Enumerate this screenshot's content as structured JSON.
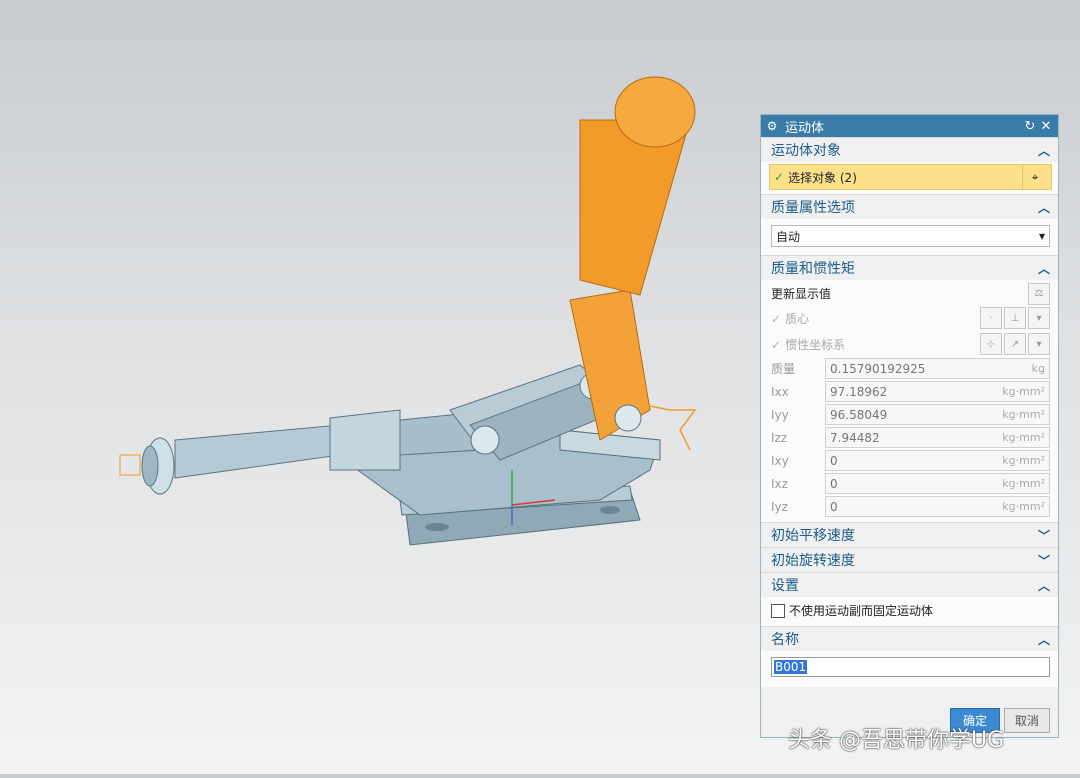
{
  "dialog": {
    "title": "运动体",
    "sections": {
      "object": {
        "title": "运动体对象",
        "select_label": "选择对象 (2)"
      },
      "mass_option": {
        "title": "质量属性选项",
        "value": "自动"
      },
      "mass_inertia": {
        "title": "质量和惯性矩",
        "update_label": "更新显示值",
        "centroid_label": "质心",
        "inertia_csys_label": "惯性坐标系",
        "fields": [
          {
            "label": "质量",
            "value": "0.15790192925",
            "unit": "kg"
          },
          {
            "label": "Ixx",
            "value": "97.18962",
            "unit": "kg·mm²"
          },
          {
            "label": "Iyy",
            "value": "96.58049",
            "unit": "kg·mm²"
          },
          {
            "label": "Izz",
            "value": "7.94482",
            "unit": "kg·mm²"
          },
          {
            "label": "Ixy",
            "value": "0",
            "unit": "kg·mm²"
          },
          {
            "label": "Ixz",
            "value": "0",
            "unit": "kg·mm²"
          },
          {
            "label": "Iyz",
            "value": "0",
            "unit": "kg·mm²"
          }
        ]
      },
      "init_trans": {
        "title": "初始平移速度"
      },
      "init_rot": {
        "title": "初始旋转速度"
      },
      "settings": {
        "title": "设置",
        "checkbox_label": "不使用运动副而固定运动体"
      },
      "name": {
        "title": "名称",
        "value": "B001"
      }
    },
    "footer": {
      "ok_label": "确定",
      "cancel_label": "取消"
    }
  },
  "watermark": "头条 @吾思带你学UG",
  "colors": {
    "title_bar": "#3a7ca8",
    "highlight": "#fce18a",
    "orange_part": "#f29b2b",
    "steel_part": "#9fb8c4"
  }
}
